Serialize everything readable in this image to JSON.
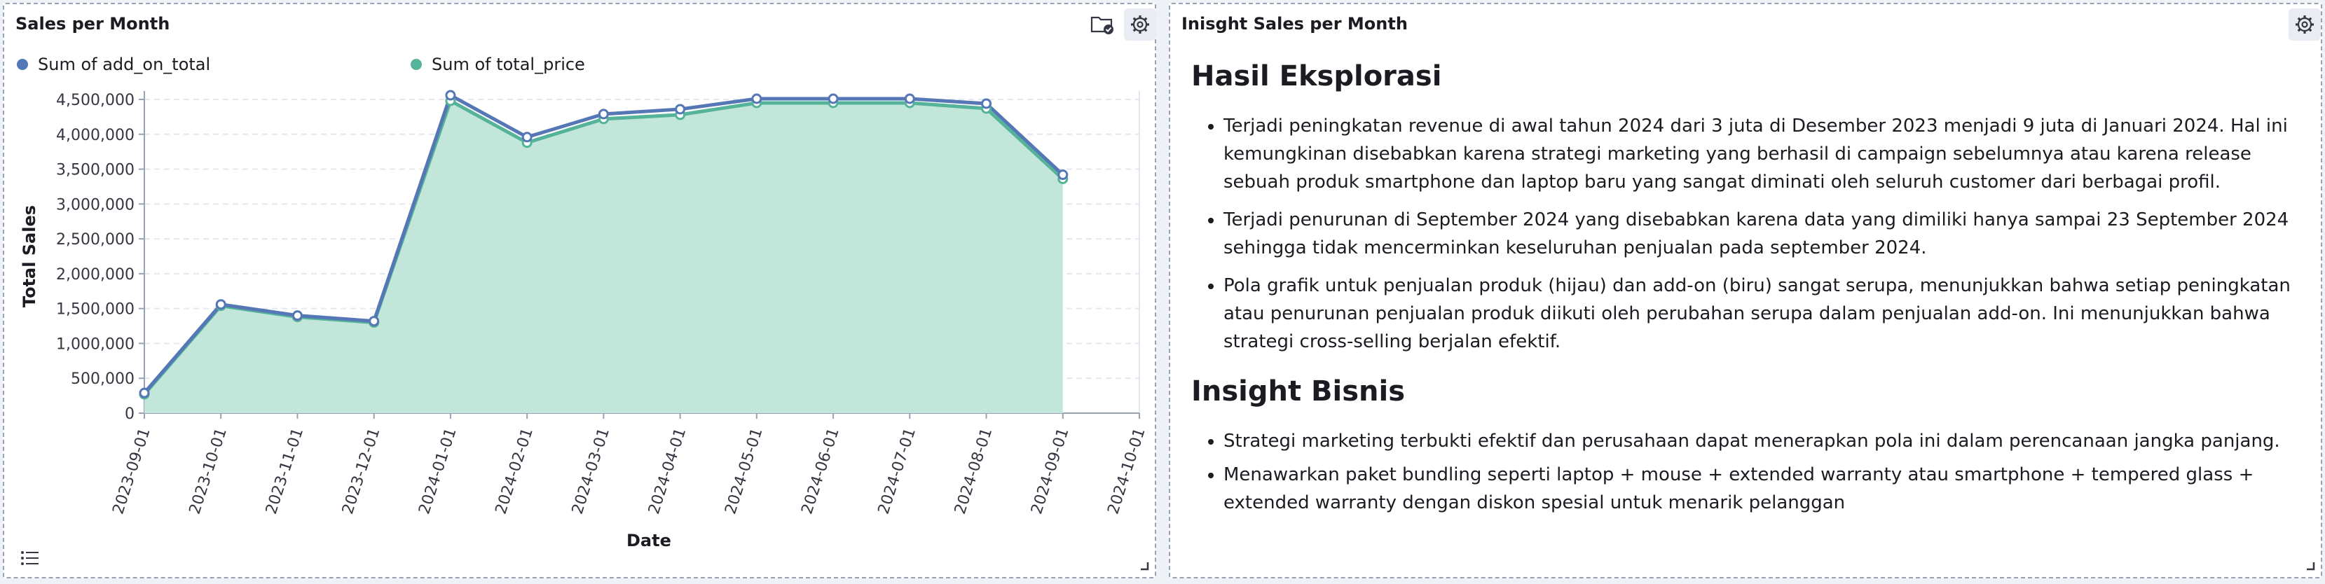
{
  "left_panel": {
    "title": "Sales per Month",
    "legend": [
      {
        "label": "Sum of add_on_total",
        "color": "#5677b5"
      },
      {
        "label": "Sum of total_price",
        "color": "#54b399"
      }
    ],
    "icons": [
      "folder-check-icon",
      "gear-icon",
      "list-icon",
      "resize-handle-icon"
    ]
  },
  "right_panel": {
    "title": "Inisght Sales per Month",
    "icons": [
      "gear-icon",
      "resize-handle-icon"
    ],
    "section1_heading": "Hasil Eksplorasi",
    "section1_items": [
      "Terjadi peningkatan revenue di awal tahun 2024 dari 3 juta di Desember 2023 menjadi 9 juta di Januari 2024. Hal ini kemungkinan disebabkan karena strategi marketing yang berhasil di campaign sebelumnya atau karena release sebuah produk smartphone dan laptop baru yang sangat diminati oleh seluruh customer dari berbagai profil.",
      "Terjadi penurunan di September 2024 yang disebabkan karena data yang dimiliki hanya sampai 23 September 2024 sehingga tidak mencerminkan keseluruhan penjualan pada september 2024.",
      "Pola grafik untuk penjualan produk (hijau) dan add-on (biru) sangat serupa, menunjukkan bahwa setiap peningkatan atau penurunan penjualan produk diikuti oleh perubahan serupa dalam penjualan add-on. Ini menunjukkan bahwa strategi cross-selling berjalan efektif."
    ],
    "section2_heading": "Insight Bisnis",
    "section2_items": [
      "Strategi marketing terbukti efektif dan perusahaan dapat menerapkan pola ini dalam perencanaan jangka panjang.",
      "Menawarkan paket bundling seperti laptop + mouse + extended warranty atau smartphone + tempered glass + extended warranty dengan diskon spesial untuk menarik pelanggan"
    ]
  },
  "chart_data": {
    "type": "area",
    "title": "Sales per Month",
    "xlabel": "Date",
    "ylabel": "Total Sales",
    "ylim": [
      0,
      4500000
    ],
    "y_ticks": [
      0,
      500000,
      1000000,
      1500000,
      2000000,
      2500000,
      3000000,
      3500000,
      4000000,
      4500000
    ],
    "y_tick_labels": [
      "0",
      "500,000",
      "1,000,000",
      "1,500,000",
      "2,000,000",
      "2,500,000",
      "3,000,000",
      "3,500,000",
      "4,000,000",
      "4,500,000"
    ],
    "x_tick_labels": [
      "2023-09-01",
      "2023-10-01",
      "2023-11-01",
      "2023-12-01",
      "2024-01-01",
      "2024-02-01",
      "2024-03-01",
      "2024-04-01",
      "2024-05-01",
      "2024-06-01",
      "2024-07-01",
      "2024-08-01",
      "2024-09-01",
      "2024-10-01"
    ],
    "categories": [
      "2023-09-01",
      "2023-10-01",
      "2023-11-01",
      "2023-12-01",
      "2024-01-01",
      "2024-02-01",
      "2024-03-01",
      "2024-04-01",
      "2024-05-01",
      "2024-06-01",
      "2024-07-01",
      "2024-08-01",
      "2024-09-01"
    ],
    "grid": true,
    "legend_position": "top-left",
    "series": [
      {
        "name": "Sum of add_on_total",
        "type": "line",
        "color": "#5677b5",
        "values": [
          290000,
          1560000,
          1400000,
          1320000,
          4560000,
          3960000,
          4290000,
          4360000,
          4510000,
          4510000,
          4510000,
          4440000,
          3420000
        ]
      },
      {
        "name": "Sum of total_price",
        "type": "area",
        "color": "#54b399",
        "values": [
          270000,
          1540000,
          1380000,
          1300000,
          4480000,
          3880000,
          4220000,
          4280000,
          4450000,
          4450000,
          4450000,
          4370000,
          3360000
        ]
      }
    ]
  }
}
